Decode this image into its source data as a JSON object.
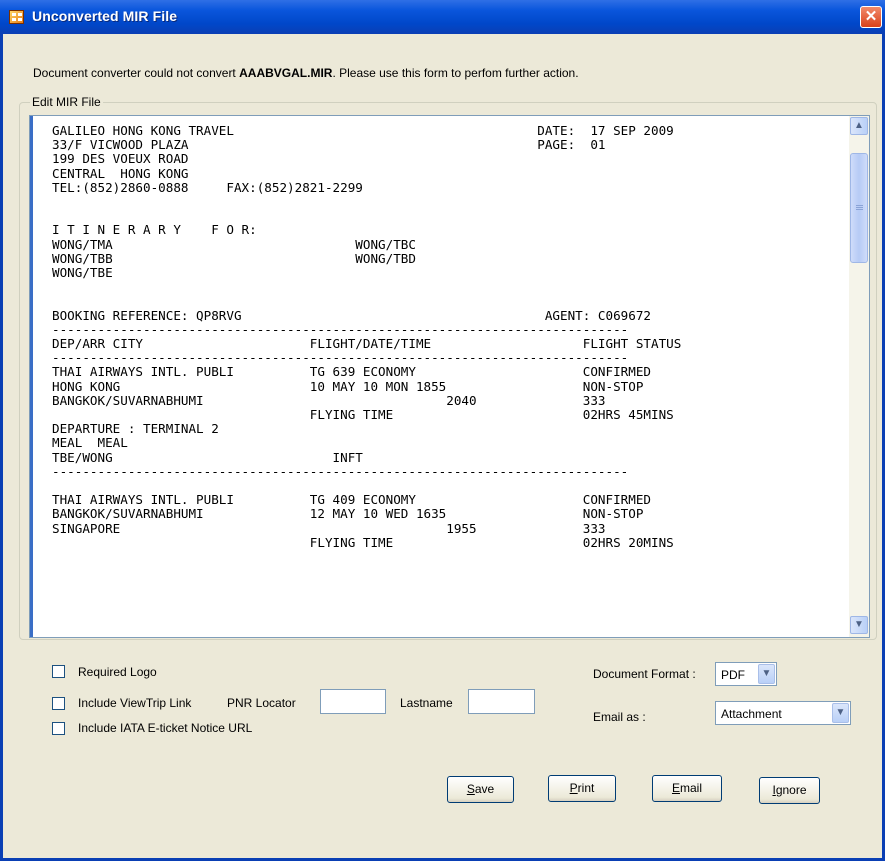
{
  "window": {
    "title": "Unconverted MIR File",
    "close_glyph": "✕"
  },
  "message": {
    "prefix": "Document converter could not convert ",
    "filename": "AAABVGAL.MIR",
    "suffix": ". Please use this form to perfom further action."
  },
  "editor": {
    "group_label": "Edit MIR File",
    "content": "GALILEO HONG KONG TRAVEL                                        DATE:  17 SEP 2009\n33/F VICWOOD PLAZA                                              PAGE:  01\n199 DES VOEUX ROAD\nCENTRAL  HONG KONG\nTEL:(852)2860-0888     FAX:(852)2821-2299\n\n\nI T I N E R A R Y    F O R:\nWONG/TMA                                WONG/TBC\nWONG/TBB                                WONG/TBD\nWONG/TBE\n\n\nBOOKING REFERENCE: QP8RVG                                        AGENT: C069672\n----------------------------------------------------------------------------\nDEP/ARR CITY                      FLIGHT/DATE/TIME                    FLIGHT STATUS\n----------------------------------------------------------------------------\nTHAI AIRWAYS INTL. PUBLI          TG 639 ECONOMY                      CONFIRMED\nHONG KONG                         10 MAY 10 MON 1855                  NON-STOP\nBANGKOK/SUVARNABHUMI                                2040              333\n                                  FLYING TIME                         02HRS 45MINS\nDEPARTURE : TERMINAL 2\nMEAL  MEAL\nTBE/WONG                             INFT\n----------------------------------------------------------------------------\n\nTHAI AIRWAYS INTL. PUBLI          TG 409 ECONOMY                      CONFIRMED\nBANGKOK/SUVARNABHUMI              12 MAY 10 WED 1635                  NON-STOP\nSINGAPORE                                           1955              333\n                                  FLYING TIME                         02HRS 20MINS",
    "scroll_up_glyph": "▲",
    "scroll_down_glyph": "▼"
  },
  "options": {
    "required_logo": "Required Logo",
    "include_viewtrip": "Include ViewTrip Link",
    "pnr_locator_label": "PNR Locator",
    "pnr_locator_value": "",
    "lastname_label": "Lastname",
    "lastname_value": "",
    "include_iata": "Include IATA E-ticket Notice URL"
  },
  "format": {
    "document_format_label": "Document Format :",
    "document_format_value": "PDF",
    "email_as_label": "Email as :",
    "email_as_value": "Attachment",
    "dropdown_glyph": "▼"
  },
  "buttons": {
    "save": {
      "mnemonic": "S",
      "rest": "ave"
    },
    "print": {
      "mnemonic": "P",
      "rest": "rint"
    },
    "email": {
      "mnemonic": "E",
      "rest": "mail"
    },
    "ignore": {
      "mnemonic": "I",
      "rest": "gnore"
    }
  },
  "colors": {
    "titlebar": "#0047c9",
    "window_bg": "#ece9d8",
    "close_button": "#d9411a"
  }
}
